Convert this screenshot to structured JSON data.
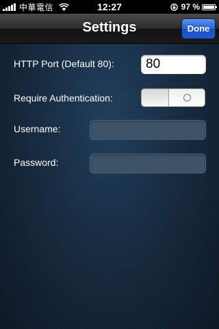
{
  "status_bar": {
    "carrier": "中華電信",
    "time": "12:27",
    "battery_percent": "97 %",
    "battery_level": 0.97,
    "icons": [
      "signal-icon",
      "wifi-icon",
      "rotation-lock-icon",
      "battery-icon"
    ]
  },
  "nav": {
    "title": "Settings",
    "done_label": "Done"
  },
  "form": {
    "http_port": {
      "label": "HTTP Port (Default 80):",
      "value": "80"
    },
    "require_auth": {
      "label": "Require Authentication:",
      "state": "off",
      "off_symbol": "O"
    },
    "username": {
      "label": "Username:",
      "value": ""
    },
    "password": {
      "label": "Password:",
      "value": ""
    }
  },
  "colors": {
    "accent_button": "#2c63d8",
    "background": "#14263a",
    "field_dark": "#3d5266"
  }
}
